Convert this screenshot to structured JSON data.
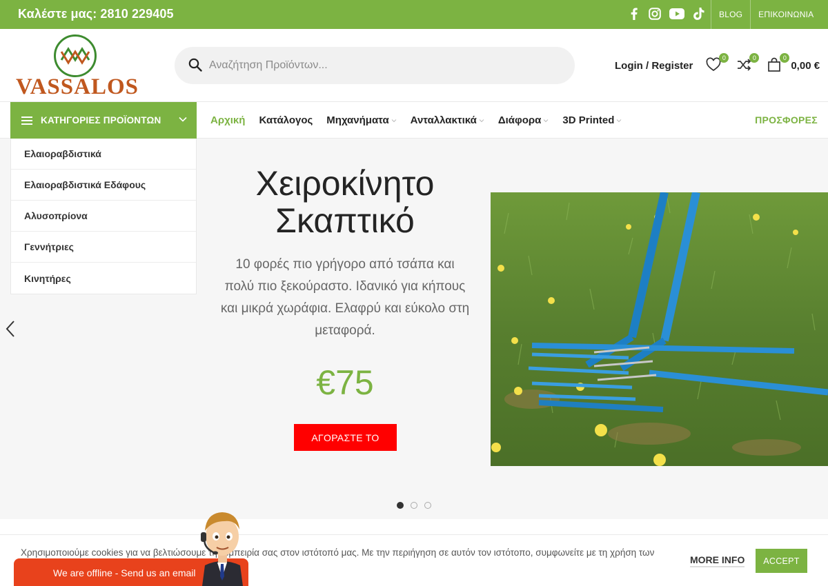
{
  "topbar": {
    "phone": "Καλέστε μας: 2810 229405",
    "socials": [
      "facebook-icon",
      "instagram-icon",
      "youtube-icon",
      "tiktok-icon"
    ],
    "links": [
      "BLOG",
      "ΕΠΙΚΟΙΝΩΝΙΑ"
    ]
  },
  "header": {
    "logo_text": "VASSALOS",
    "search_placeholder": "Αναζήτηση Προϊόντων...",
    "login_label": "Login / Register",
    "wishlist_count": "0",
    "compare_count": "0",
    "cart_count": "0",
    "cart_total": "0,00 €"
  },
  "nav": {
    "categories_label": "ΚΑΤΗΓΟΡΙΕΣ ΠΡΟΪΟΝΤΩΝ",
    "items": [
      {
        "label": "Αρχική"
      },
      {
        "label": "Κατάλογος"
      },
      {
        "label": "Μηχανήματα"
      },
      {
        "label": "Ανταλλακτικά"
      },
      {
        "label": "Διάφορα"
      },
      {
        "label": "3D Printed"
      }
    ],
    "offers_label": "ΠΡΟΣΦΟΡΕΣ"
  },
  "categories": [
    "Ελαιοραβδιστικά",
    "Ελαιοραβδιστικά Εδάφους",
    "Αλυσοπρίονα",
    "Γεννήτριες",
    "Κινητήρες"
  ],
  "hero": {
    "title_line1": "Χειροκίνητο",
    "title_line2": "Σκαπτικό",
    "description": "10 φορές πιο γρήγορο από τσάπα και πολύ πιο ξεκούραστο. Ιδανικό για κήπους και μικρά χωράφια. Ελαφρύ και εύκολο στη μεταφορά.",
    "price": "€75",
    "button_label": "ΑΓΟΡΑΣΤΕ ΤΟ",
    "slide_count": 3,
    "active_slide": 1
  },
  "cookie": {
    "text": "Χρησιμοποιούμε cookies για να βελτιώσουμε την εμπειρία σας στον ιστότοπό μας. Με την περιήγηση σε αυτόν τον ιστότοπο, συμφωνείτε με τη χρήση των",
    "more_info": "MORE INFO",
    "accept": "ACCEPT"
  },
  "chat": {
    "label": "We are offline - Send us an email"
  },
  "colors": {
    "brand_green": "#7cb342",
    "buy_red": "#ff0000",
    "chat_orange": "#e8421c",
    "logo_orange": "#c0581f"
  }
}
